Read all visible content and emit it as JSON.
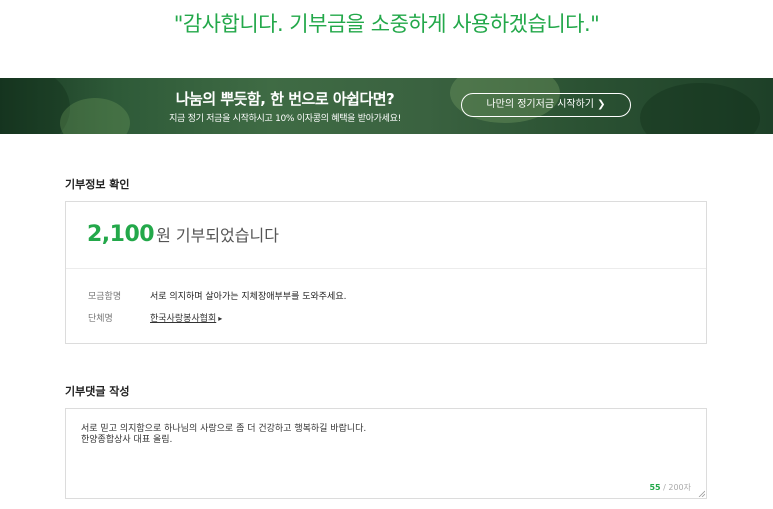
{
  "header": {
    "thanks_message": "\"감사합니다. 기부금을 소중하게 사용하겠습니다.\""
  },
  "banner": {
    "title": "나눔의 뿌듯함, 한 번으로 아쉽다면?",
    "subtitle": "지금 정기 저금을 시작하시고 10% 이자콩의 혜택을 받아가세요!",
    "button_label": "나만의 정기저금 시작하기 ❯"
  },
  "donation_info": {
    "section_title": "기부정보 확인",
    "amount": "2,100",
    "amount_suffix": "원 기부되었습니다",
    "fundraiser_label": "모금함명",
    "fundraiser_value": "서로 의지하며 살아가는 지체장애부부를 도와주세요.",
    "org_label": "단체명",
    "org_value": "한국사랑봉사협회",
    "org_arrow": "▸"
  },
  "comment": {
    "section_title": "기부댓글 작성",
    "text": "서로 믿고 의지함으로 하나님의 사랑으로 좀 더 건강하고 행복하길 바랍니다.\n한양종합상사 대표 올림.",
    "count_current": "55",
    "count_max": " / 200자"
  },
  "colors": {
    "accent": "#23a84a"
  }
}
